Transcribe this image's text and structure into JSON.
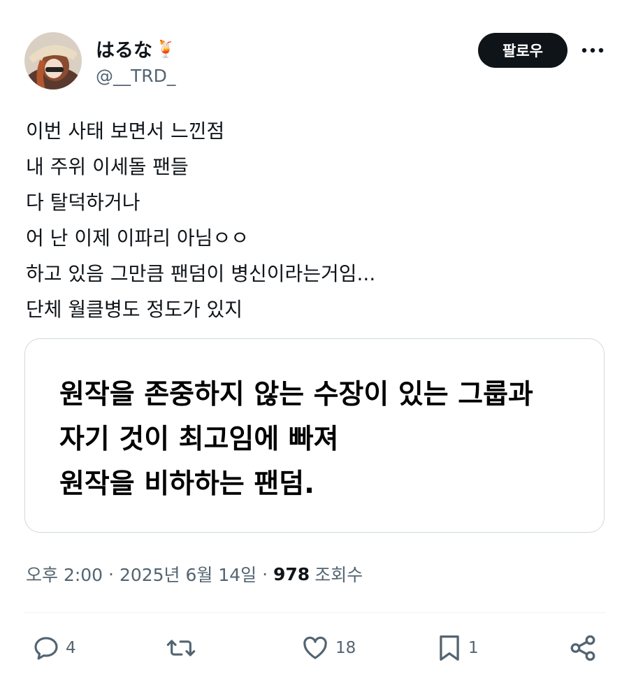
{
  "author": {
    "display_name": "はるな",
    "emoji": "🍹",
    "handle": "@__TRD_"
  },
  "header": {
    "follow_label": "팔로우",
    "more_icon": "more-horizontal-icon"
  },
  "tweet": {
    "lines": [
      "이번 사태 보면서 느낀점",
      "내 주위 이세돌 팬들",
      "다 탈덕하거나",
      "어 난 이제 이파리 아님ㅇㅇ",
      "하고 있음 그만큼 팬덤이 병신이라는거임...",
      "단체 월클병도 정도가 있지"
    ]
  },
  "card": {
    "lines": [
      "원작을 존중하지 않는 수장이 있는 그룹과",
      "자기 것이 최고임에 빠져",
      "원작을 비하하는 팬덤."
    ]
  },
  "meta": {
    "time": "오후 2:00",
    "separator": " · ",
    "date": "2025년 6월 14일",
    "views_count": "978",
    "views_label": "조회수"
  },
  "actions": {
    "reply_count": "4",
    "retweet_count": "",
    "like_count": "18",
    "bookmark_count": "1"
  },
  "colors": {
    "text": "#0f1419",
    "secondary": "#536471",
    "border": "#cfd9de",
    "follow_bg": "#0f1419"
  }
}
